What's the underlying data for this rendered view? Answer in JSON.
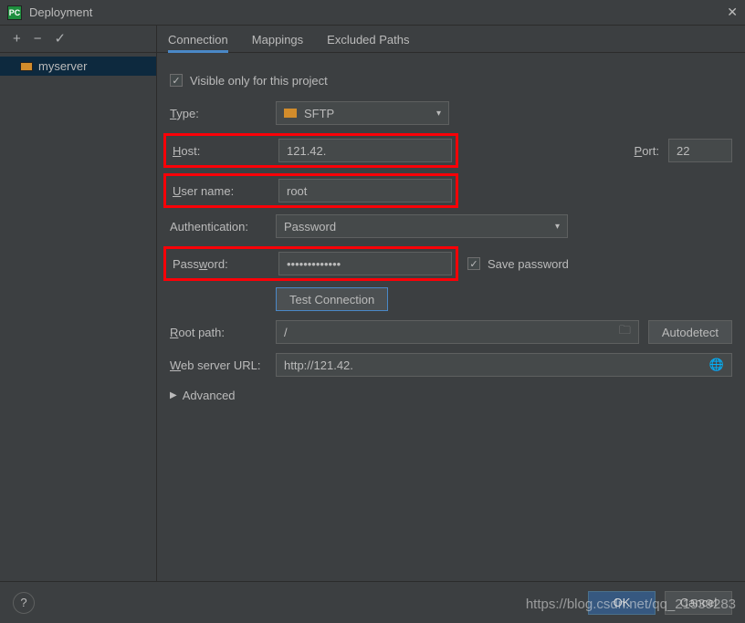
{
  "title": "Deployment",
  "sidebar": {
    "servers": [
      {
        "name": "myserver"
      }
    ]
  },
  "tabs": {
    "connection": "Connection",
    "mappings": "Mappings",
    "excluded": "Excluded Paths"
  },
  "visible_only": "Visible only for this project",
  "labels": {
    "type": "Type:",
    "host": "Host:",
    "port": "Port:",
    "user": "User name:",
    "auth": "Authentication:",
    "password": "Password:",
    "savepwd": "Save password",
    "test": "Test Connection",
    "rootpath": "Root path:",
    "weburl": "Web server URL:",
    "autodetect": "Autodetect",
    "advanced": "Advanced"
  },
  "values": {
    "type": "SFTP",
    "host": "121.42.",
    "port": "22",
    "user": "root",
    "auth": "Password",
    "password": "•••••••••••••",
    "rootpath": "/",
    "weburl": "http://121.42."
  },
  "footer": {
    "ok": "OK",
    "cancel": "Cancel"
  },
  "watermark": "https://blog.csdn.net/qq_21539283"
}
